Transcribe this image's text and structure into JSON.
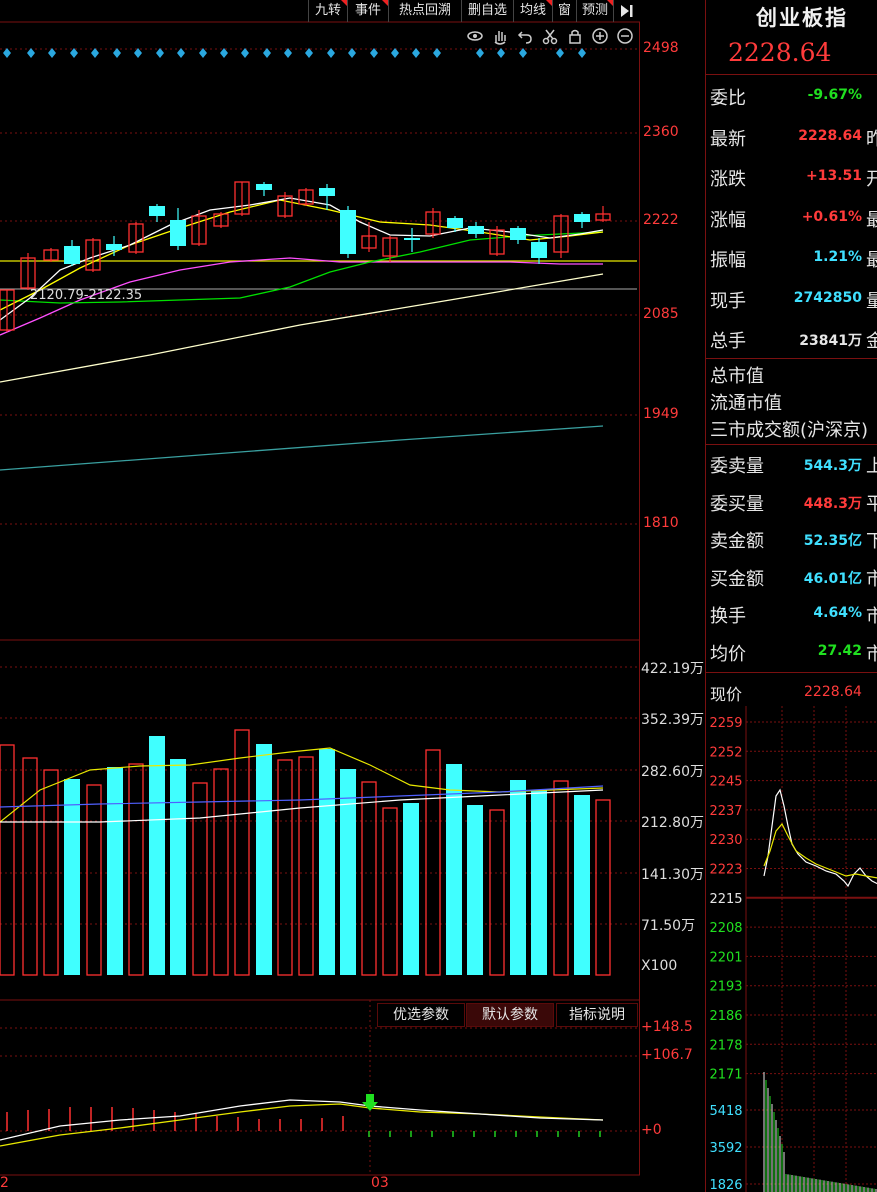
{
  "toolbar": {
    "buttons": [
      {
        "label": "九转",
        "flag": true
      },
      {
        "label": "事件",
        "flag": true
      },
      {
        "label": "热点回溯",
        "flag": false
      },
      {
        "label": "删自选",
        "flag": false
      },
      {
        "label": "均线",
        "flag": true
      },
      {
        "label": "窗",
        "flag": false
      },
      {
        "label": "预测",
        "flag": true
      }
    ],
    "tool_icons": [
      "eye-icon",
      "hand-icon",
      "undo-icon",
      "scissors-icon",
      "lock-icon",
      "zoom-in-icon",
      "zoom-out-icon"
    ]
  },
  "kline": {
    "price_ticks": [
      "2498",
      "2360",
      "2222",
      "2085",
      "1949",
      "1810"
    ],
    "range_label": "2120.79-2122.35",
    "colors": {
      "up": "#ff3030",
      "down": "#40ffff",
      "ma5": "#ffffff",
      "ma10": "#ffff00",
      "ma20": "#ff50ff",
      "ma60": "#00e000",
      "ma120": "#ffffcc",
      "ma250": "#3aa0a0"
    }
  },
  "volume": {
    "ticks": [
      "422.19万",
      "352.39万",
      "282.60万",
      "212.80万",
      "141.30万",
      "71.50万"
    ],
    "multiplier": "X100"
  },
  "indicator": {
    "buttons": [
      "优选参数",
      "默认参数",
      "指标说明"
    ],
    "ticks": [
      "+148.5",
      "+106.7",
      "+0"
    ]
  },
  "date_axis": [
    "2",
    "03"
  ],
  "panel": {
    "title": "创业板指",
    "price": "2228.64",
    "rows": [
      {
        "label": "委比",
        "value": "-9.67%",
        "color": "#20e020",
        "edge": ""
      },
      {
        "label": "最新",
        "value": "2228.64",
        "color": "#ff3b3b",
        "edge": "昨"
      },
      {
        "label": "涨跌",
        "value": "+13.51",
        "color": "#ff3b3b",
        "edge": "开"
      },
      {
        "label": "涨幅",
        "value": "+0.61%",
        "color": "#ff3b3b",
        "edge": "最"
      },
      {
        "label": "振幅",
        "value": "1.21%",
        "color": "#40e0ff",
        "edge": "最"
      },
      {
        "label": "现手",
        "value": "2742850",
        "color": "#40e0ff",
        "edge": "量"
      },
      {
        "label": "总手",
        "value": "23841万",
        "color": "#e6e6e6",
        "edge": "金"
      }
    ],
    "plain_rows": [
      "总市值",
      "流通市值",
      "三市成交额(沪深京)"
    ],
    "rows2": [
      {
        "label": "委卖量",
        "value": "544.3万",
        "color": "#40e0ff",
        "edge": "上"
      },
      {
        "label": "委买量",
        "value": "448.3万",
        "color": "#ff3b3b",
        "edge": "平"
      },
      {
        "label": "卖金额",
        "value": "52.35亿",
        "color": "#40e0ff",
        "edge": "下"
      },
      {
        "label": "买金额",
        "value": "46.01亿",
        "color": "#40e0ff",
        "edge": "市"
      },
      {
        "label": "换手",
        "value": "4.64%",
        "color": "#40e0ff",
        "edge": "市"
      },
      {
        "label": "均价",
        "value": "27.42",
        "color": "#20e020",
        "edge": "市"
      }
    ],
    "current_label": "现价",
    "current_value": "2228.64",
    "mini_ticks": [
      "2259",
      "2252",
      "2245",
      "2237",
      "2230",
      "2223",
      "2215",
      "2208",
      "2201",
      "2193",
      "2186",
      "2178",
      "2171"
    ],
    "mini_vol_ticks": [
      "5418",
      "3592",
      "1826"
    ]
  }
}
